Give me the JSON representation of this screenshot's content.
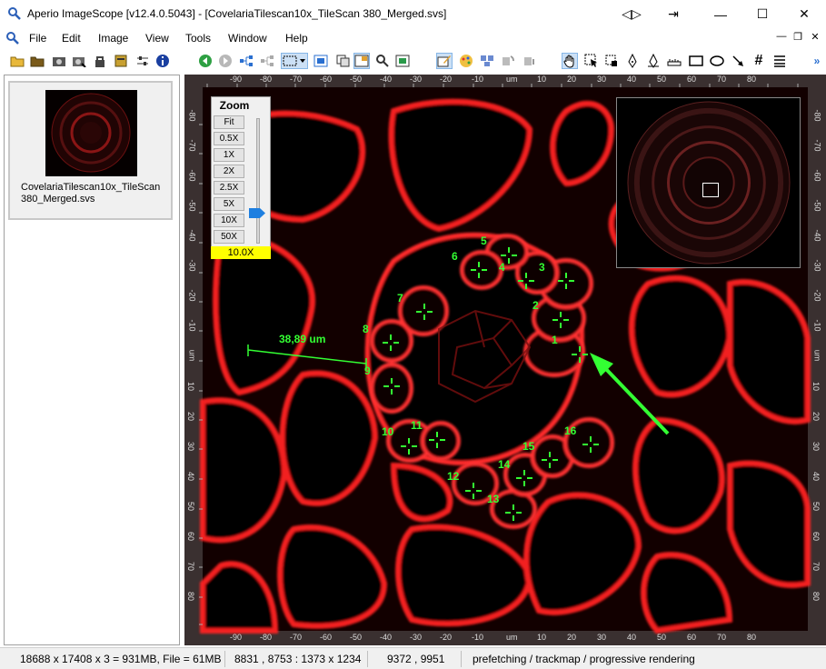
{
  "window": {
    "title": "Aperio ImageScope [v12.4.0.5043] - [CovelariaTilescan10x_TileScan 380_Merged.svs]",
    "controls": [
      "◁▷",
      "⇥",
      "—",
      "☐",
      "✕"
    ]
  },
  "menu": {
    "items": [
      "File",
      "Edit",
      "Image",
      "View",
      "Tools",
      "Window",
      "Help"
    ],
    "mdi_controls": [
      "—",
      "❐",
      "✕"
    ]
  },
  "toolbar": {
    "overflow": "»"
  },
  "sidebar": {
    "thumbnail_caption": "CovelariaTilescan10x_TileScan 380_Merged.svs"
  },
  "zoom_panel": {
    "title": "Zoom",
    "buttons": [
      "Fit",
      "0.5X",
      "1X",
      "2X",
      "2.5X",
      "5X",
      "10X",
      "50X"
    ],
    "current": "10.0X",
    "slider_fraction": 0.73
  },
  "ruler": {
    "unit": "um",
    "top_labels": [
      "-90",
      "-80",
      "-70",
      "-60",
      "-50",
      "-40",
      "-30",
      "-20",
      "-10",
      "um",
      "10",
      "20",
      "30",
      "40",
      "50",
      "60",
      "70",
      "80"
    ],
    "left_labels": [
      "-80",
      "-70",
      "-60",
      "-50",
      "-40",
      "-30",
      "-20",
      "-10",
      "um",
      "10",
      "20",
      "30",
      "40",
      "50",
      "60",
      "70",
      "80"
    ]
  },
  "annotations": {
    "measurement": "38,89 um",
    "markers": [
      "1",
      "2",
      "3",
      "4",
      "5",
      "6",
      "7",
      "8",
      "9",
      "10",
      "11",
      "12",
      "13",
      "14",
      "15",
      "16"
    ]
  },
  "status": {
    "dimensions": "18688 x 17408 x 3 = 931MB, File = 61MB",
    "view_region": "8831 , 8753 : 1373 x 1234",
    "cursor": "9372 , 9951",
    "mode": "prefetching / trackmap / progressive rendering"
  },
  "colors": {
    "tissue": "#ff1e1e",
    "marker": "#33ff33",
    "zoom_value_bg": "#ffff00",
    "accent": "#1e7fe0"
  }
}
